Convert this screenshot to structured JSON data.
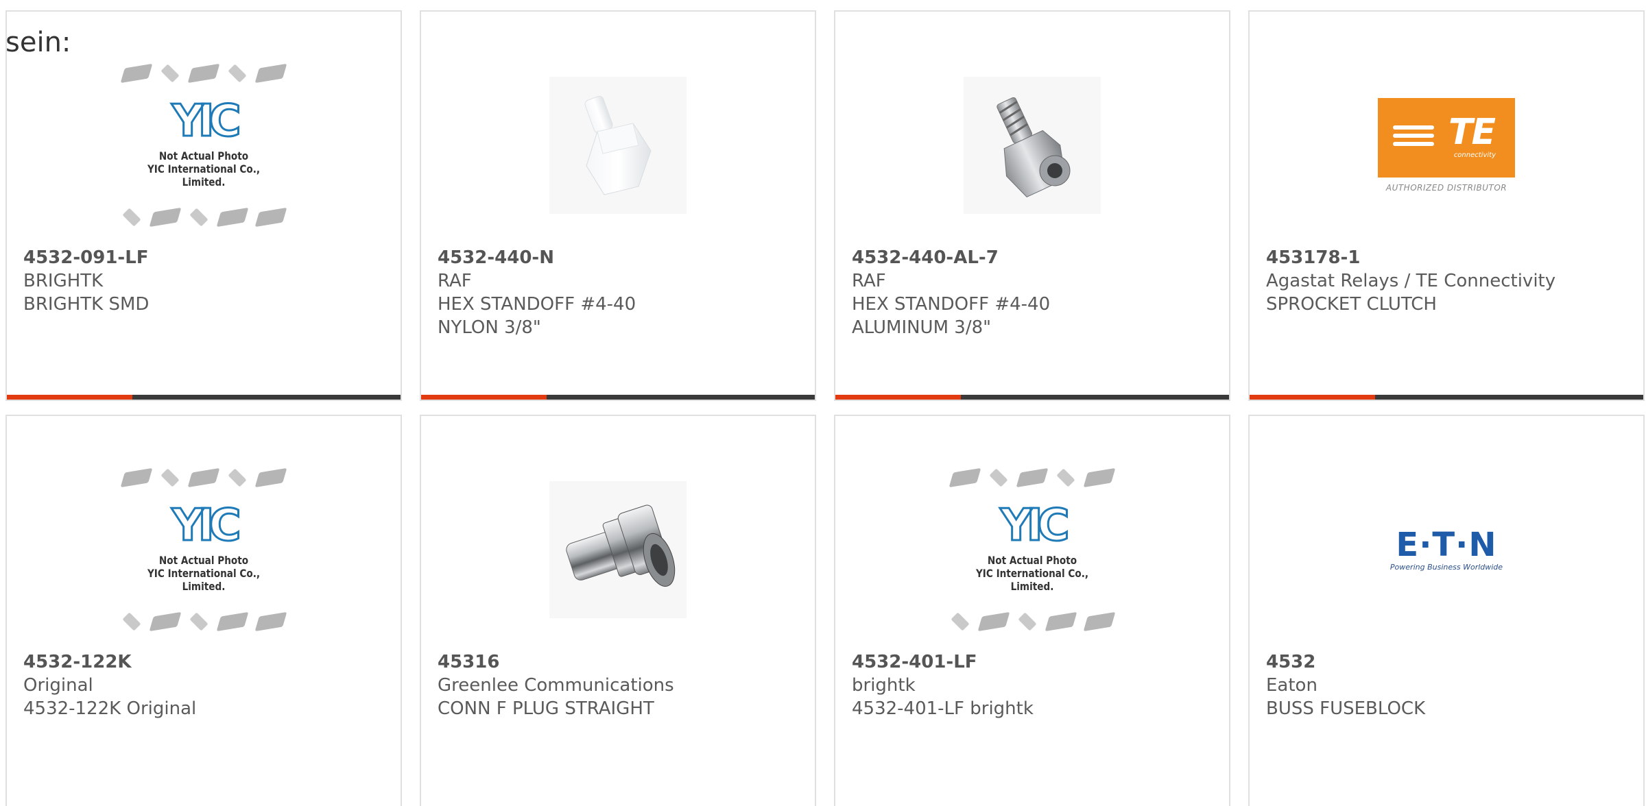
{
  "fragment_text": "sein:",
  "placeholder": {
    "logo": "YIC",
    "note_line1": "Not Actual Photo",
    "note_line2": "YIC International Co., Limited."
  },
  "te_logo": {
    "word": "TE",
    "sub": "connectivity",
    "authorized": "AUTHORIZED DISTRIBUTOR"
  },
  "eaton_logo": {
    "word": "E·T·N",
    "tagline": "Powering Business Worldwide"
  },
  "colors": {
    "accent": "#e23b12",
    "bar": "#3a3a3a",
    "te_orange": "#f28e1f",
    "eaton_blue": "#1e5ba8",
    "yic_blue": "#1f7ab8"
  },
  "products": [
    {
      "part": "4532-091-LF",
      "manufacturer": "BRIGHTK",
      "description": "BRIGHTK SMD",
      "image": "yic-placeholder"
    },
    {
      "part": "4532-440-N",
      "manufacturer": "RAF",
      "description": "HEX STANDOFF #4-40 NYLON 3/8\"",
      "image": "nylon-standoff-photo"
    },
    {
      "part": "4532-440-AL-7",
      "manufacturer": "RAF",
      "description": "HEX STANDOFF #4-40 ALUMINUM 3/8\"",
      "image": "aluminum-standoff-photo"
    },
    {
      "part": "453178-1",
      "manufacturer": "Agastat Relays / TE Connectivity",
      "description": "SPROCKET CLUTCH",
      "image": "te-logo"
    },
    {
      "part": "4532-122K",
      "manufacturer": "Original",
      "description": "4532-122K Original",
      "image": "yic-placeholder"
    },
    {
      "part": "45316",
      "manufacturer": "Greenlee Communications",
      "description": "CONN F PLUG STRAIGHT",
      "image": "f-connector-photo"
    },
    {
      "part": "4532-401-LF",
      "manufacturer": "brightk",
      "description": "4532-401-LF brightk",
      "image": "yic-placeholder"
    },
    {
      "part": "4532",
      "manufacturer": "Eaton",
      "description": "BUSS FUSEBLOCK",
      "image": "eaton-logo"
    }
  ]
}
